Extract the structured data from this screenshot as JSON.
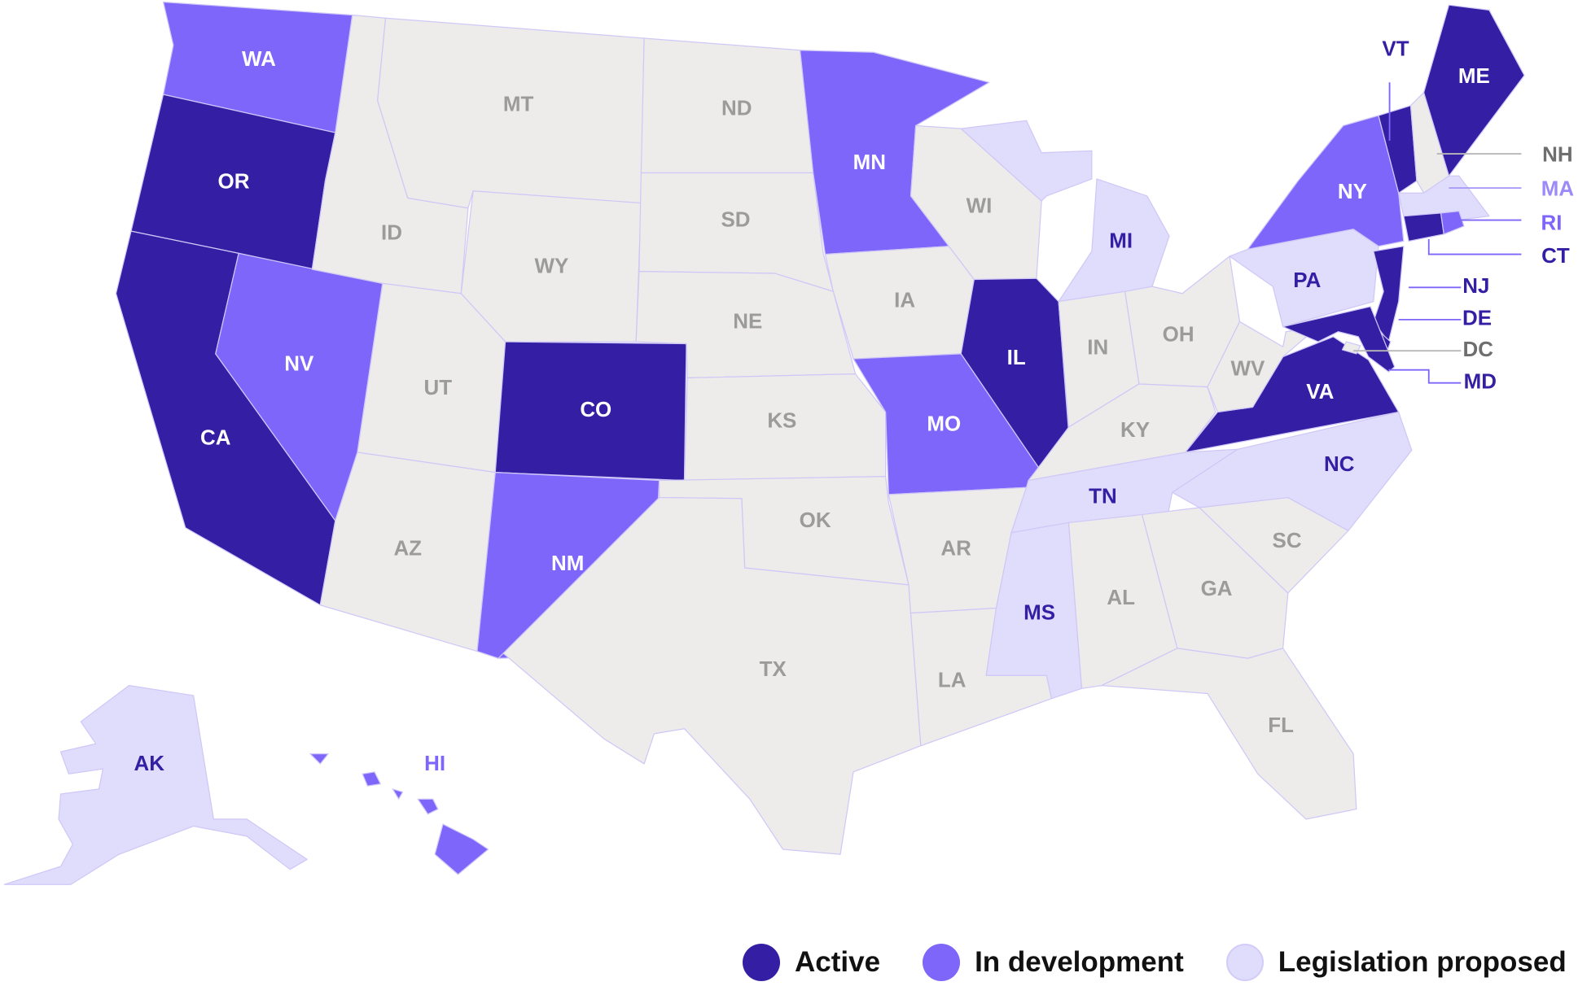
{
  "colors": {
    "active": "#341ea3",
    "in_development": "#7f66fb",
    "legislation_proposed": "#e0dcfb",
    "none": "#edecea",
    "border": "#cfc8f7",
    "label_none": "#9b9b9b"
  },
  "legend": [
    {
      "key": "active",
      "label": "Active"
    },
    {
      "key": "in_development",
      "label": "In development"
    },
    {
      "key": "legislation_proposed",
      "label": "Legislation proposed"
    }
  ],
  "states": [
    {
      "abbr": "WA",
      "status": "in_development"
    },
    {
      "abbr": "OR",
      "status": "active"
    },
    {
      "abbr": "CA",
      "status": "active"
    },
    {
      "abbr": "NV",
      "status": "in_development"
    },
    {
      "abbr": "ID",
      "status": "none"
    },
    {
      "abbr": "MT",
      "status": "none"
    },
    {
      "abbr": "WY",
      "status": "none"
    },
    {
      "abbr": "UT",
      "status": "none"
    },
    {
      "abbr": "AZ",
      "status": "none"
    },
    {
      "abbr": "CO",
      "status": "active"
    },
    {
      "abbr": "NM",
      "status": "in_development"
    },
    {
      "abbr": "ND",
      "status": "none"
    },
    {
      "abbr": "SD",
      "status": "none"
    },
    {
      "abbr": "NE",
      "status": "none"
    },
    {
      "abbr": "KS",
      "status": "none"
    },
    {
      "abbr": "OK",
      "status": "none"
    },
    {
      "abbr": "TX",
      "status": "none"
    },
    {
      "abbr": "MN",
      "status": "in_development"
    },
    {
      "abbr": "IA",
      "status": "none"
    },
    {
      "abbr": "MO",
      "status": "in_development"
    },
    {
      "abbr": "AR",
      "status": "none"
    },
    {
      "abbr": "LA",
      "status": "none"
    },
    {
      "abbr": "WI",
      "status": "none"
    },
    {
      "abbr": "IL",
      "status": "active"
    },
    {
      "abbr": "MI",
      "status": "legislation_proposed"
    },
    {
      "abbr": "IN",
      "status": "none"
    },
    {
      "abbr": "OH",
      "status": "none"
    },
    {
      "abbr": "KY",
      "status": "none"
    },
    {
      "abbr": "TN",
      "status": "legislation_proposed"
    },
    {
      "abbr": "MS",
      "status": "legislation_proposed"
    },
    {
      "abbr": "AL",
      "status": "none"
    },
    {
      "abbr": "GA",
      "status": "none"
    },
    {
      "abbr": "FL",
      "status": "none"
    },
    {
      "abbr": "SC",
      "status": "none"
    },
    {
      "abbr": "NC",
      "status": "legislation_proposed"
    },
    {
      "abbr": "VA",
      "status": "active"
    },
    {
      "abbr": "WV",
      "status": "none"
    },
    {
      "abbr": "PA",
      "status": "legislation_proposed"
    },
    {
      "abbr": "NY",
      "status": "in_development"
    },
    {
      "abbr": "NJ",
      "status": "active"
    },
    {
      "abbr": "DE",
      "status": "active"
    },
    {
      "abbr": "MD",
      "status": "active"
    },
    {
      "abbr": "DC",
      "status": "none"
    },
    {
      "abbr": "VT",
      "status": "active"
    },
    {
      "abbr": "NH",
      "status": "none"
    },
    {
      "abbr": "ME",
      "status": "active"
    },
    {
      "abbr": "MA",
      "status": "legislation_proposed"
    },
    {
      "abbr": "CT",
      "status": "active"
    },
    {
      "abbr": "RI",
      "status": "in_development"
    },
    {
      "abbr": "AK",
      "status": "legislation_proposed"
    },
    {
      "abbr": "HI",
      "status": "in_development"
    }
  ]
}
